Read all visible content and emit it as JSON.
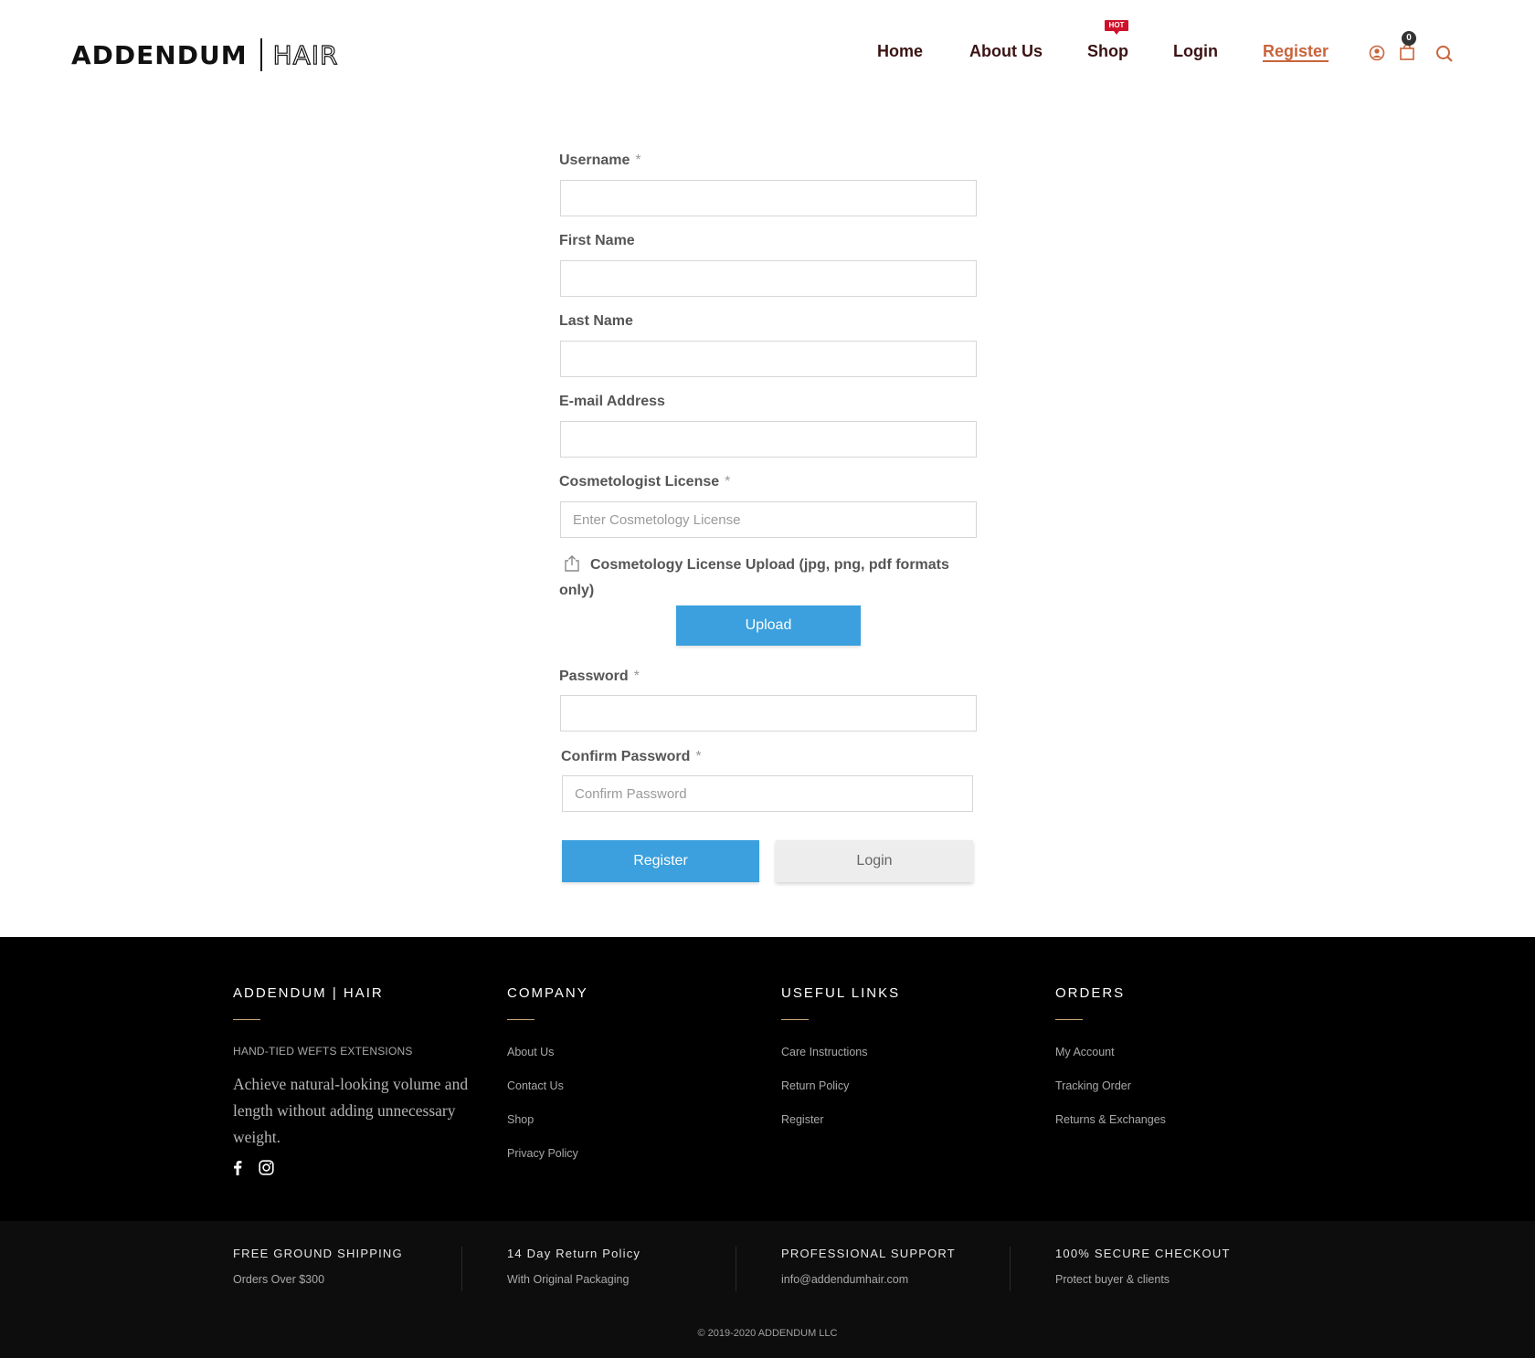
{
  "header": {
    "logo_main": "ADDENDUM",
    "logo_sub": "HAIR",
    "nav": [
      {
        "label": "Home"
      },
      {
        "label": "About Us"
      },
      {
        "label": "Shop"
      },
      {
        "label": "Login"
      },
      {
        "label": "Register",
        "active": true
      }
    ],
    "hot_badge": "HOT",
    "cart_count": "0",
    "icons": [
      "user-icon",
      "cart-icon",
      "search-icon"
    ],
    "accent_color": "#c8643b",
    "nav_color": "#3a1313"
  },
  "form": {
    "username": {
      "label": "Username",
      "required": "*",
      "value": ""
    },
    "first_name": {
      "label": "First Name",
      "value": ""
    },
    "last_name": {
      "label": "Last Name",
      "value": ""
    },
    "email": {
      "label": "E-mail Address",
      "value": ""
    },
    "license": {
      "label": "Cosmetologist License",
      "required": "*",
      "placeholder": "Enter Cosmetology License",
      "value": ""
    },
    "license_upload": {
      "label": "Cosmetology License Upload (jpg, png, pdf formats only)",
      "button": "Upload"
    },
    "password": {
      "label": "Password",
      "required": "*",
      "value": ""
    },
    "confirm_password": {
      "label": "Confirm Password",
      "required": "*",
      "placeholder": "Confirm Password",
      "value": ""
    },
    "register_button": "Register",
    "login_button": "Login",
    "primary_color": "#3ba0dd"
  },
  "footer": {
    "col1": {
      "title": "ADDENDUM | HAIR",
      "tagline": "HAND-TIED WEFTS EXTENSIONS",
      "description": "Achieve natural-looking volume and length without adding unnecessary weight.",
      "socials": [
        "facebook-icon",
        "instagram-icon"
      ]
    },
    "col2": {
      "title": "COMPANY",
      "links": [
        "About Us",
        "Contact Us",
        "Shop",
        "Privacy Policy"
      ]
    },
    "col3": {
      "title": "USEFUL LINKS",
      "links": [
        "Care Instructions",
        "Return Policy",
        "Register"
      ]
    },
    "col4": {
      "title": "ORDERS",
      "links": [
        "My Account",
        "Tracking Order",
        "Returns & Exchanges"
      ]
    },
    "features": [
      {
        "title": "FREE GROUND SHIPPING",
        "sub": "Orders Over $300"
      },
      {
        "title": "14 Day Return Policy",
        "sub": "With Original Packaging"
      },
      {
        "title": "PROFESSIONAL SUPPORT",
        "sub": "info@addendumhair.com"
      },
      {
        "title": "100% SECURE CHECKOUT",
        "sub": "Protect buyer & clients"
      }
    ],
    "copyright": "© 2019-2020 ADDENDUM LLC"
  }
}
